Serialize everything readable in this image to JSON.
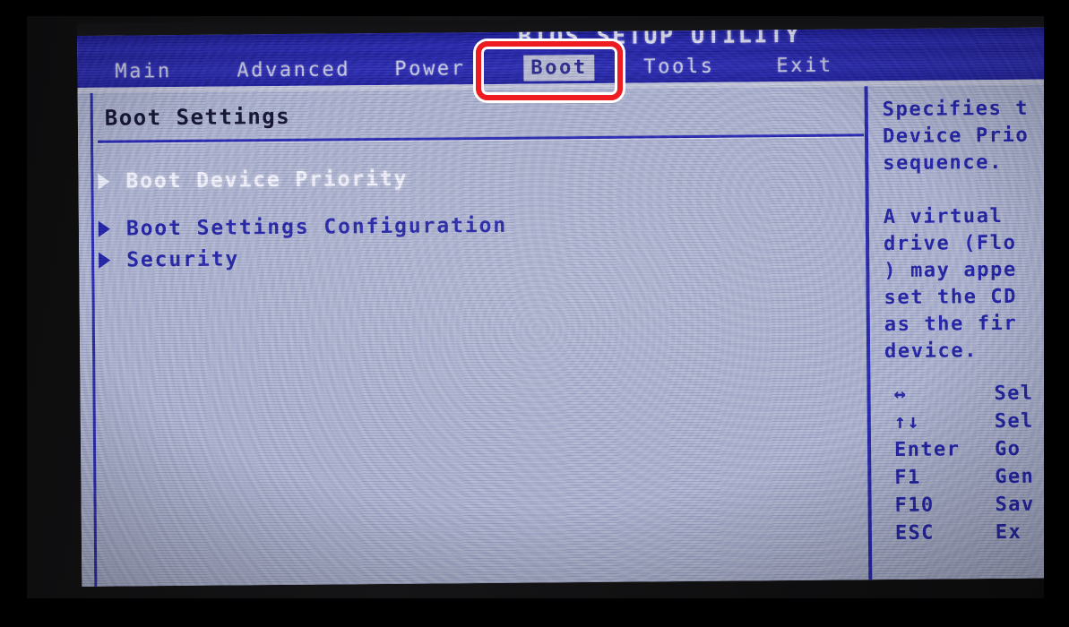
{
  "window": {
    "title": "BIOS SETUP UTILITY"
  },
  "menubar": {
    "tabs": [
      {
        "id": "main",
        "label": "Main",
        "active": false
      },
      {
        "id": "advanced",
        "label": "Advanced",
        "active": false
      },
      {
        "id": "power",
        "label": "Power",
        "active": false
      },
      {
        "id": "boot",
        "label": "Boot",
        "active": true
      },
      {
        "id": "tools",
        "label": "Tools",
        "active": false
      },
      {
        "id": "exit",
        "label": "Exit",
        "active": false
      }
    ]
  },
  "main": {
    "section_title": "Boot Settings",
    "items": [
      {
        "id": "boot-device-priority",
        "label": "Boot Device Priority",
        "arrow": "submenu-arrow-icon",
        "selected": true
      },
      {
        "id": "boot-settings-configuration",
        "label": "Boot Settings Configuration",
        "arrow": "submenu-arrow-icon",
        "selected": false
      },
      {
        "id": "security",
        "label": "Security",
        "arrow": "submenu-arrow-icon",
        "selected": false
      }
    ]
  },
  "help": {
    "paragraph_1_lines": [
      "Specifies t",
      "Device Prio",
      "sequence."
    ],
    "paragraph_2_lines": [
      "A virtual ",
      "drive (Flo",
      ") may appe",
      "set the CD",
      "as the fir",
      "device."
    ],
    "legend": [
      {
        "key": "↔",
        "key_icon": "left-right-arrow-icon",
        "desc": "Sel"
      },
      {
        "key": "↑↓",
        "key_icon": "up-down-arrow-icon",
        "desc": "Sel"
      },
      {
        "key": "Enter",
        "key_icon": "enter-key",
        "desc": "Go"
      },
      {
        "key": "F1",
        "key_icon": "f1-key",
        "desc": "Gen"
      },
      {
        "key": "F10",
        "key_icon": "f10-key",
        "desc": "Sav"
      },
      {
        "key": "ESC",
        "key_icon": "esc-key",
        "desc": "Ex"
      }
    ]
  },
  "annotation": {
    "type": "red-rounded-rectangle-highlight",
    "target": "boot-tab",
    "color": "#ee1c20"
  },
  "colors": {
    "screen_background": "#aeb4d2",
    "menubar_blue": "#2e2eb6",
    "title_blue": "#2b2bb4",
    "text_blue": "#2222a8",
    "selected_text": "#f2f3ff",
    "annotation_red": "#ee1c20",
    "bezel_black": "#0c0c0d"
  }
}
